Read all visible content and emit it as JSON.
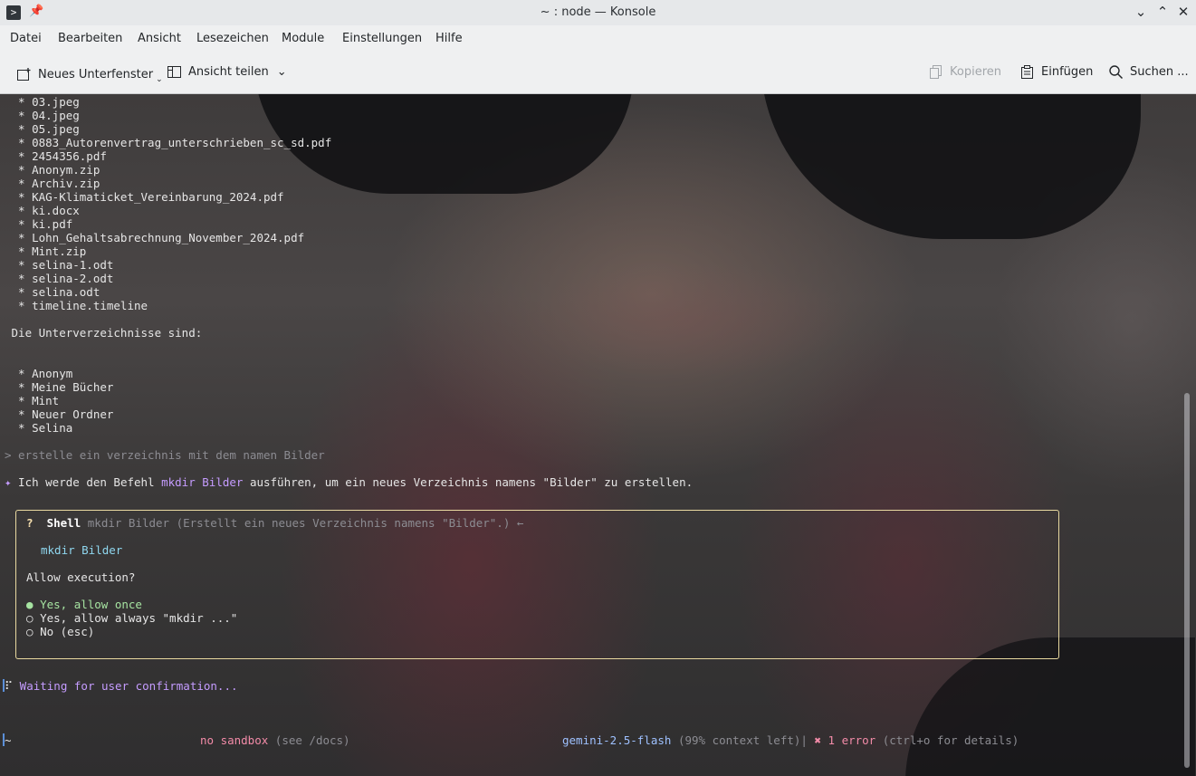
{
  "window": {
    "title": "~ : node — Konsole"
  },
  "menubar": {
    "items": [
      "Datei",
      "Bearbeiten",
      "Ansicht",
      "Lesezeichen",
      "Module",
      "Einstellungen",
      "Hilfe"
    ]
  },
  "toolbar": {
    "new_tab_label": "Neues Unterfenster",
    "split_view_label": "Ansicht teilen",
    "copy_label": "Kopieren",
    "paste_label": "Einfügen",
    "search_label": "Suchen ..."
  },
  "terminal": {
    "file_lines": [
      "  * 03.jpeg",
      "  * 04.jpeg",
      "  * 05.jpeg",
      "  * 0883_Autorenvertrag_unterschrieben_sc_sd.pdf",
      "  * 2454356.pdf",
      "  * Anonym.zip",
      "  * Archiv.zip",
      "  * KAG-Klimaticket_Vereinbarung_2024.pdf",
      "  * ki.docx",
      "  * ki.pdf",
      "  * Lohn_Gehaltsabrechnung_November_2024.pdf",
      "  * Mint.zip",
      "  * selina-1.odt",
      "  * selina-2.odt",
      "  * selina.odt",
      "  * timeline.timeline"
    ],
    "subdirs_heading": " Die Unterverzeichnisse sind:",
    "subdir_lines": [
      "  * Anonym",
      "  * Meine Bücher",
      "  * Mint",
      "  * Neuer Ordner",
      "  * Selina"
    ],
    "prompt_line": "> erstelle ein verzeichnis mit dem namen Bilder",
    "response": {
      "marker": "✦",
      "part1": " Ich werde den Befehl ",
      "command": "mkdir Bilder",
      "part2": " ausführen, um ein neues Verzeichnis namens \"Bilder\" zu erstellen."
    },
    "dialog": {
      "question_mark": "?",
      "tool_name": "Shell",
      "tool_desc": "mkdir Bilder (Erstellt ein neues Verzeichnis namens \"Bilder\".) ←",
      "command": "mkdir Bilder",
      "question": "Allow execution?",
      "options": [
        {
          "marker": "●",
          "label": "Yes, allow once"
        },
        {
          "marker": "○",
          "label": "Yes, allow always \"mkdir ...\""
        },
        {
          "marker": "○",
          "label": "No (esc)"
        }
      ]
    },
    "waiting": {
      "spinner": "⠏",
      "text": " Waiting for user confirmation..."
    },
    "statusbar": {
      "cwd": "~",
      "sandbox": "no sandbox",
      "sandbox_hint": " (see /docs)",
      "model": "gemini-2.5-flash",
      "context": " (99% context left)|",
      "error_mark": " ✖ 1 error",
      "error_hint": " (ctrl+o for details)"
    }
  }
}
